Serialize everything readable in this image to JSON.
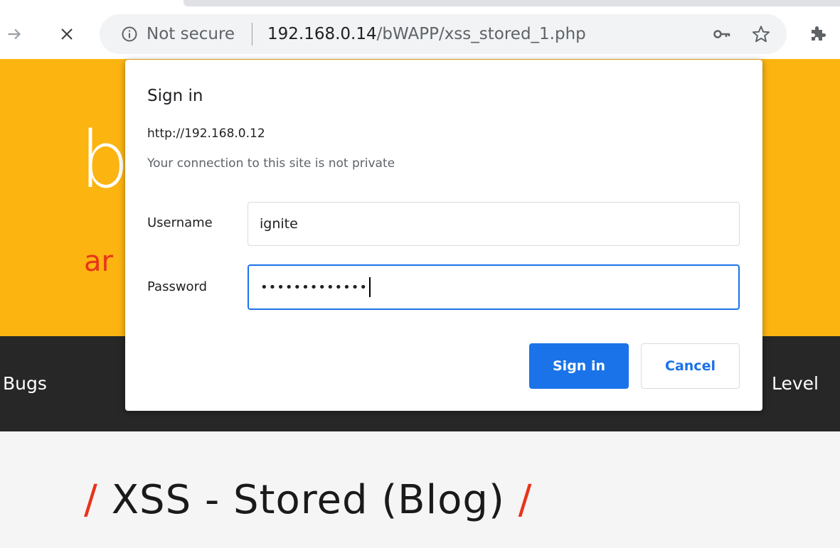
{
  "browser": {
    "security_label": "Not secure",
    "url_host": "192.168.0.14",
    "url_path": "/bWAPP/xss_stored_1.php"
  },
  "dialog": {
    "title": "Sign in",
    "origin": "http://192.168.0.12",
    "warning": "Your connection to this site is not private",
    "username_label": "Username",
    "username_value": "ignite",
    "password_label": "Password",
    "password_mask": "•••••••••••••",
    "signin_label": "Sign in",
    "cancel_label": "Cancel"
  },
  "page": {
    "logo_letter": "b",
    "logo_sub": "ar",
    "menu_bugs": "Bugs",
    "menu_level": "Level",
    "title_slash_left": "/",
    "title_text": "XSS - Stored (Blog)",
    "title_slash_right": "/"
  },
  "colors": {
    "header_bg": "#fcb411",
    "menubar_bg": "#272727",
    "accent_red": "#e8341c",
    "button_blue": "#1a73e8"
  },
  "icons": {
    "forward": "forward-arrow-icon",
    "stop": "close-icon",
    "info": "info-icon",
    "key": "key-icon",
    "star": "star-icon",
    "extensions": "puzzle-icon"
  }
}
